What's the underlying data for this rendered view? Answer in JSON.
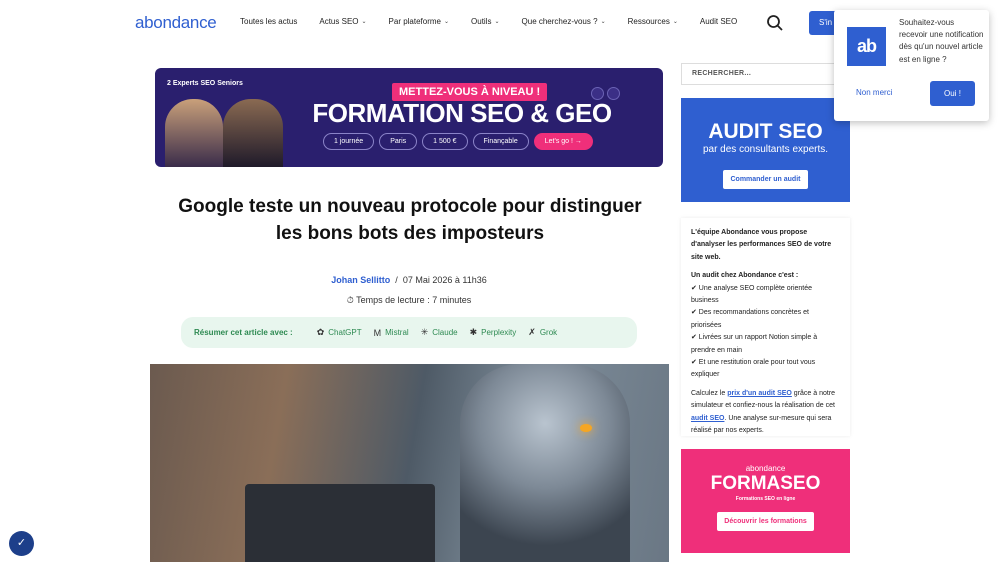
{
  "header": {
    "logo": "abondance",
    "nav": [
      {
        "label": "Toutes les actus",
        "dropdown": false
      },
      {
        "label": "Actus SEO",
        "dropdown": true
      },
      {
        "label": "Par plateforme",
        "dropdown": true
      },
      {
        "label": "Outils",
        "dropdown": true
      },
      {
        "label": "Que cherchez-vous ?",
        "dropdown": true
      },
      {
        "label": "Ressources",
        "dropdown": true
      },
      {
        "label": "Audit SEO",
        "dropdown": false
      }
    ],
    "signin_label": "S'in",
    "search_icon": "search-icon"
  },
  "promo": {
    "badge": "2 Experts SEO Seniors",
    "tag": "METTEZ-VOUS À NIVEAU !",
    "headline": "FORMATION SEO & GEO",
    "pills": [
      "1 journée",
      "Paris",
      "1 500 €",
      "Finançable",
      "Let's go ! →"
    ]
  },
  "article": {
    "title": "Google teste un nouveau protocole pour distinguer les bons bots des imposteurs",
    "author": "Johan Sellitto",
    "separator": "/",
    "date": "07 Mai 2026 à 11h36",
    "reading_time": "Temps de lecture : 7 minutes",
    "summarize_label": "Résumer cet article avec :",
    "ai_tools": [
      {
        "icon": "chatgpt-icon",
        "glyph": "✿",
        "label": "ChatGPT"
      },
      {
        "icon": "mistral-icon",
        "glyph": "M",
        "label": "Mistral"
      },
      {
        "icon": "claude-icon",
        "glyph": "✳",
        "label": "Claude"
      },
      {
        "icon": "perplexity-icon",
        "glyph": "✱",
        "label": "Perplexity"
      },
      {
        "icon": "grok-icon",
        "glyph": "✗",
        "label": "Grok"
      }
    ]
  },
  "sidebar": {
    "search_placeholder": "RECHERCHER...",
    "audit": {
      "title": "AUDIT SEO",
      "subtitle": "par des consultants experts.",
      "button": "Commander un audit"
    },
    "info": {
      "intro": "L'équipe Abondance vous propose d'analyser les performances SEO de votre site web.",
      "heading": "Un audit chez Abondance c'est :",
      "items": [
        "✔ Une analyse SEO complète orientée business",
        "✔ Des recommandations concrètes et priorisées",
        "✔ Livrées sur un rapport Notion simple à prendre en main",
        "✔ Et une restitution orale pour tout vous expliquer"
      ],
      "p1": "Calculez le ",
      "link1": "prix d'un audit SEO",
      "p2": " grâce à notre simulateur et confiez-nous la réalisation de cet ",
      "link2": "audit SEO",
      "p3": ". Une analyse sur-mesure qui sera réalisé par nos experts."
    },
    "forma": {
      "small": "abondance",
      "title": "FORMASEO",
      "subtitle": "Formations SEO en ligne",
      "button": "Découvrir les formations"
    }
  },
  "notification": {
    "logo": "ab",
    "message": "Souhaitez-vous recevoir une notification dès qu'un nouvel article est en ligne ?",
    "decline": "Non merci",
    "accept": "Oui !"
  },
  "colors": {
    "brand": "#2f5fd0",
    "pink": "#ef2f7a",
    "summary_bg": "#e8f6ee",
    "summary_text": "#2e8a52"
  }
}
